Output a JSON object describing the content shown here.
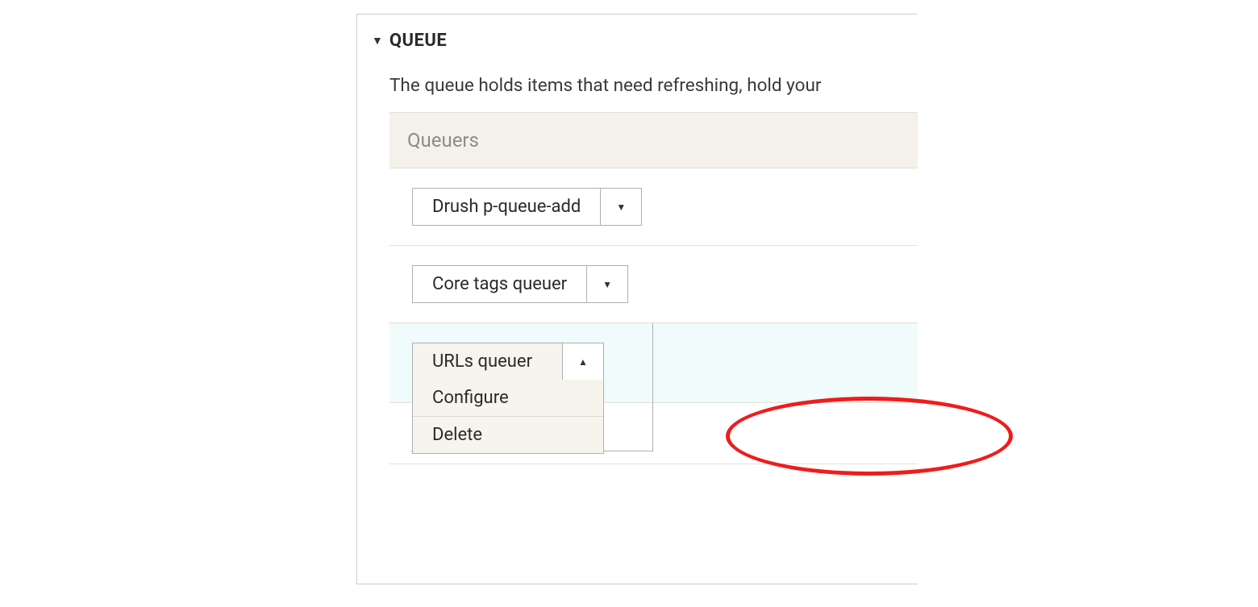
{
  "section": {
    "title": "QUEUE",
    "description": "The queue holds items that need refreshing, hold your"
  },
  "queuers": {
    "header": "Queuers",
    "items": [
      {
        "label": "Drush p-queue-add",
        "open": false
      },
      {
        "label": "Core tags queuer",
        "open": false
      },
      {
        "label": "URLs queuer",
        "open": true,
        "options": [
          "Configure",
          "Delete"
        ]
      }
    ]
  }
}
